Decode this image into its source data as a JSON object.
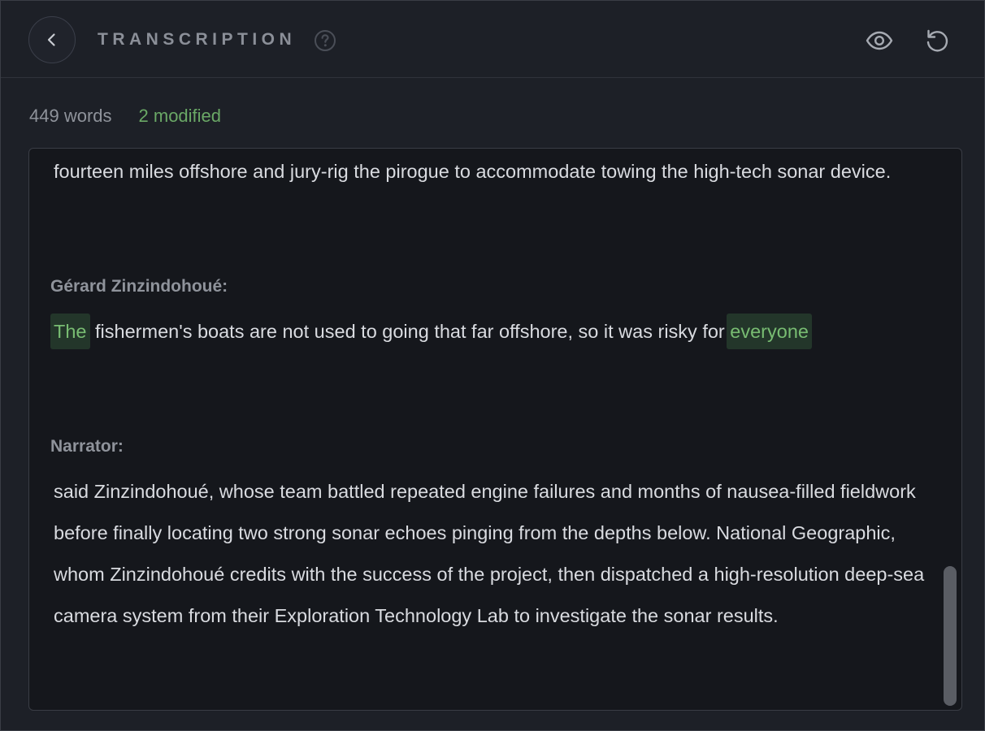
{
  "header": {
    "title": "TRANSCRIPTION",
    "back_icon": "chevron-left-icon",
    "help_icon": "question-circle-icon",
    "preview_icon": "eye-icon",
    "reset_icon": "reset-icon"
  },
  "stats": {
    "words": "449 words",
    "modified": "2 modified"
  },
  "transcript": {
    "para1": "fourteen miles offshore and jury-rig the pirogue to accommodate towing the high-tech sonar device.",
    "speaker1": "Gérard Zinzindohoué:",
    "para2_word1": "The",
    "para2_middle": " fishermen's boats are not used to going that far offshore, so it was risky for ",
    "para2_word2": "everyone",
    "speaker2": "Narrator:",
    "para3": "said Zinzindohoué, whose team battled repeated engine failures and months of nausea-filled fieldwork before finally locating two strong sonar echoes pinging from the depths below. National Geographic, whom Zinzindohoué credits with the success of the project, then dispatched a high-resolution deep-sea camera system from their Exploration Technology Lab to investigate the sonar results."
  },
  "colors": {
    "background": "#1d2027",
    "editor_bg": "#15171c",
    "modified_text": "#78bc72",
    "modified_bg": "#23362a",
    "muted_text": "#8f939b"
  }
}
